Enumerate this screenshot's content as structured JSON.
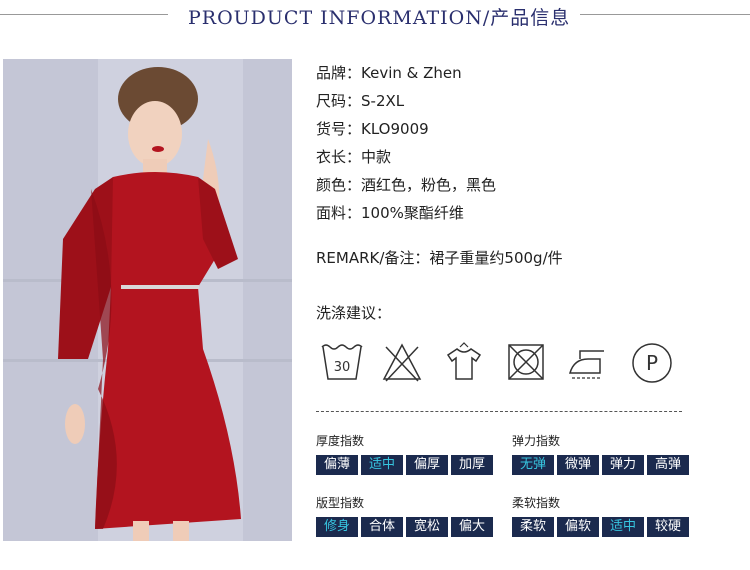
{
  "header": {
    "title": "PROUDUCT INFORMATION/产品信息"
  },
  "info": [
    {
      "label": "品牌：",
      "value": "Kevin & Zhen"
    },
    {
      "label": "尺码：",
      "value": "S-2XL"
    },
    {
      "label": "货号：",
      "value": "KLO9009"
    },
    {
      "label": "衣长：",
      "value": "中款"
    },
    {
      "label": "颜色：",
      "value": "酒红色，粉色，黑色"
    },
    {
      "label": "面料：",
      "value": "100%聚酯纤维"
    }
  ],
  "remark": {
    "label": "REMARK/备注：",
    "value": "裙子重量约500g/件"
  },
  "wash": {
    "title": "洗涤建议：",
    "icons": [
      "wash-30-icon",
      "no-bleach-icon",
      "hang-dry-icon",
      "no-tumble-dry-icon",
      "iron-icon",
      "professional-cleaning-p-icon"
    ],
    "wash_temp": "30",
    "pro_letter": "P"
  },
  "indices": [
    {
      "title": "厚度指数",
      "options": [
        "偏薄",
        "适中",
        "偏厚",
        "加厚"
      ],
      "selected": 1
    },
    {
      "title": "弹力指数",
      "options": [
        "无弹",
        "微弹",
        "弹力",
        "高弹"
      ],
      "selected": 0
    },
    {
      "title": "版型指数",
      "options": [
        "修身",
        "合体",
        "宽松",
        "偏大"
      ],
      "selected": 0
    },
    {
      "title": "柔软指数",
      "options": [
        "柔软",
        "偏软",
        "适中",
        "较硬"
      ],
      "selected": 2
    }
  ],
  "colors": {
    "title": "#2a2f6e",
    "tag_bg": "#1b2a4e",
    "tag_selected": "#37c6e0",
    "dress": "#b3141f"
  }
}
